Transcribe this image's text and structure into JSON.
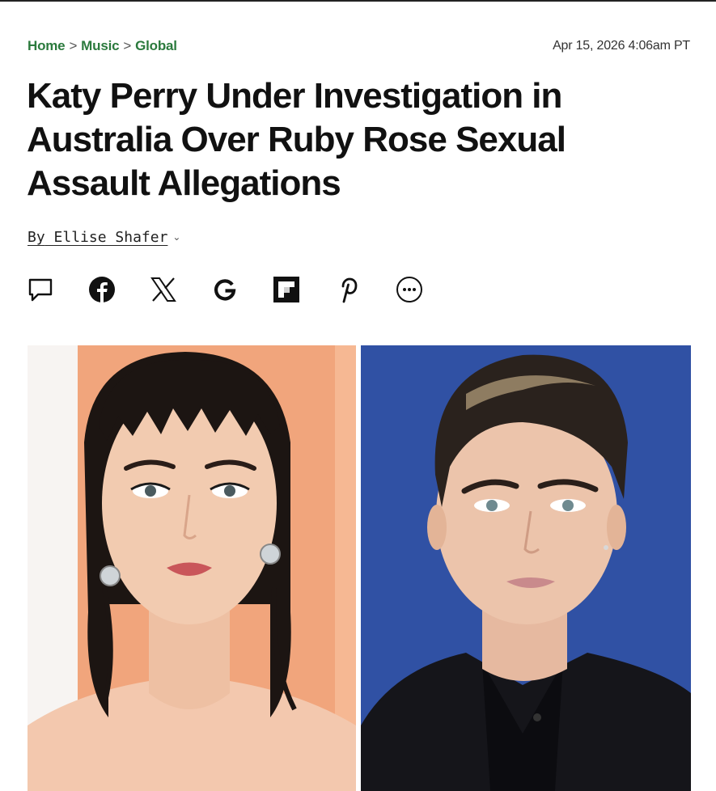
{
  "breadcrumb": {
    "home": "Home",
    "music": "Music",
    "global": "Global",
    "separator": ">"
  },
  "timestamp": "Apr 15, 2026 4:06am PT",
  "headline": "Katy Perry Under Investigation in Australia Over Ruby Rose Sexual Assault Allegations",
  "byline": {
    "prefix": "By",
    "author": "Ellise Shafer"
  },
  "share_icons": [
    "comment-icon",
    "facebook-icon",
    "x-icon",
    "google-icon",
    "flipboard-icon",
    "pinterest-icon",
    "more-icon"
  ],
  "colors": {
    "breadcrumb": "#2b7a3d",
    "text": "#111111",
    "photo_left_bg": "#f2a880",
    "photo_right_bg": "#2d4d9e"
  }
}
